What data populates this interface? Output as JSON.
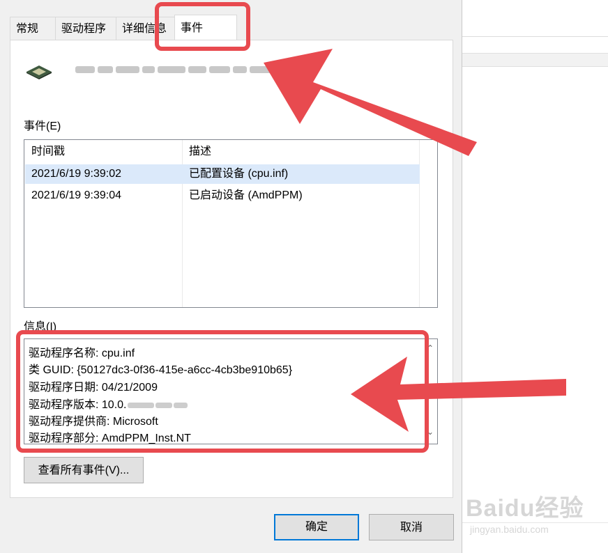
{
  "tabs": [
    {
      "label": "常规"
    },
    {
      "label": "驱动程序"
    },
    {
      "label": "详细信息"
    },
    {
      "label": "事件",
      "active": true
    }
  ],
  "events": {
    "label": "事件(E)",
    "columns": [
      "时间戳",
      "描述"
    ],
    "rows": [
      {
        "time": "2021/6/19 9:39:02",
        "desc": "已配置设备 (cpu.inf)",
        "selected": true
      },
      {
        "time": "2021/6/19 9:39:04",
        "desc": "已启动设备 (AmdPPM)",
        "selected": false
      }
    ]
  },
  "info": {
    "label": "信息(I)",
    "lines": [
      "驱动程序名称: cpu.inf",
      "类 GUID: {50127dc3-0f36-415e-a6cc-4cb3be910b65}",
      "驱动程序日期: 04/21/2009",
      "驱动程序版本: 10.0.",
      "驱动程序提供商: Microsoft",
      "驱动程序部分: AmdPPM_Inst.NT"
    ]
  },
  "buttons": {
    "view_all": "查看所有事件(V)...",
    "ok": "确定",
    "cancel": "取消"
  },
  "watermark": {
    "logo": "Baidu经验",
    "sub": "jingyan.baidu.com"
  },
  "colors": {
    "annotation": "#e84a4f",
    "selection": "#dbe9fa",
    "default_button_border": "#0078d7"
  }
}
